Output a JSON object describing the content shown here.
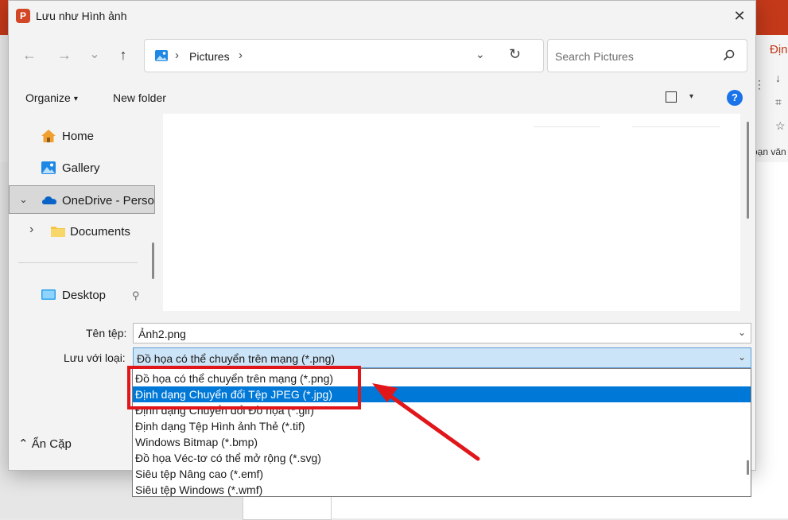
{
  "app": {
    "ribbon_text": "Địn",
    "ribbon_text2": "oạn văn"
  },
  "dialog": {
    "title": "Lưu như Hình ảnh",
    "close_glyph": "✕",
    "nav": {
      "back_glyph": "←",
      "forward_glyph": "→",
      "recent_glyph": "⌄",
      "up_glyph": "↑"
    },
    "address": {
      "path": "Pictures",
      "sep": "›",
      "dropdown_glyph": "⌄",
      "refresh_glyph": "↻"
    },
    "search": {
      "placeholder": "Search Pictures"
    },
    "toolbar": {
      "organize": "Organize",
      "new_folder": "New folder",
      "caret": "▾",
      "help": "?"
    },
    "nav_pane": {
      "items": [
        {
          "label": "Home",
          "icon": "home-icon"
        },
        {
          "label": "Gallery",
          "icon": "gallery-icon"
        },
        {
          "label": "OneDrive - Personal",
          "icon": "onedrive-icon",
          "selected": true
        },
        {
          "label": "Documents",
          "icon": "folder-icon"
        },
        {
          "label": "Desktop",
          "icon": "desktop-icon"
        }
      ],
      "chevron_down": "⌄",
      "chevron_right": "›",
      "pin_glyph": "📌"
    },
    "form": {
      "filename_label": "Tên tệp:",
      "filename_value": "Ảnh2.png",
      "type_label": "Lưu với loại:",
      "type_value": "Đồ họa có thể chuyển trên mạng (*.png)",
      "dd_glyph": "⌄"
    },
    "collapse_label": "Ẩn Cặp",
    "collapse_glyph": "⌃",
    "file_types": [
      "Đồ họa có thể chuyển trên mạng (*.png)",
      "Định dạng Chuyển đổi Tệp JPEG (*.jpg)",
      "Định dạng Chuyển đổi Đồ họa (*.gif)",
      "Định dạng Tệp Hình ảnh Thẻ (*.tif)",
      "Windows Bitmap (*.bmp)",
      "Đồ họa Véc-tơ có thể mở rộng (*.svg)",
      "Siêu tệp Nâng cao (*.emf)",
      "Siêu tệp Windows (*.wmf)"
    ],
    "selected_file_type_index": 1
  },
  "colors": {
    "accent": "#0078d7",
    "annotation": "#e1161a",
    "powerpoint": "#c4391a"
  }
}
